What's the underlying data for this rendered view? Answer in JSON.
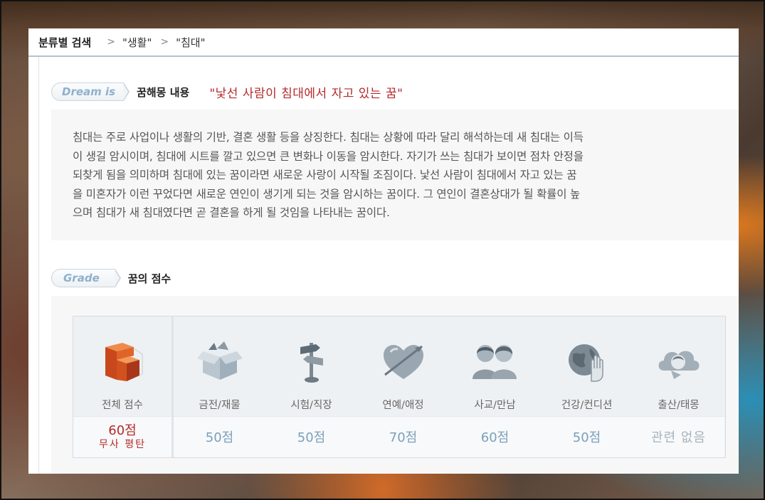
{
  "breadcrumb": {
    "title": "분류별 검색",
    "sep": ">",
    "items": [
      "\"생활\"",
      "\"침대\""
    ]
  },
  "content_section": {
    "tag": "Dream is",
    "label": "꿈해몽 내용",
    "dream_title": "\"낯선 사람이 침대에서 자고 있는 꿈\"",
    "lines": [
      "침대는 주로 사업이나 생활의 기반, 결혼 생활 등을 상징한다. 침대는 상황에 따라 달리 해석하는데 새 침대는 이득",
      "이 생길 암시이며, 침대에 시트를 깔고 있으면 큰 변화나 이동을 암시한다. 자기가 쓰는 침대가 보이면 점차 안정을",
      "되찾게 됨을 의미하며 침대에 있는 꿈이라면 새로운 사랑이 시작될 조짐이다. 낯선 사람이 침대에서 자고 있는 꿈",
      "을 미혼자가 이런 꾸었다면 새로운 연인이 생기게 되는 것을 암시하는 꿈이다. 그 연인이 결혼상대가 될 확률이 높",
      "으며 침대가 새 침대였다면 곧 결혼을 하게 될 것임을 나타내는 꿈이다."
    ]
  },
  "grade_section": {
    "tag": "Grade",
    "label": "꿈의 점수",
    "total": {
      "label": "전체 점수",
      "score": "60점",
      "verdict": "무사 평탄",
      "icon": "stacked-blocks-icon"
    },
    "categories": [
      {
        "label": "금전/재물",
        "score": "50점",
        "icon": "money-box-icon"
      },
      {
        "label": "시험/직장",
        "score": "50점",
        "icon": "signpost-icon"
      },
      {
        "label": "연예/애정",
        "score": "70점",
        "icon": "heart-arrow-icon"
      },
      {
        "label": "사교/만남",
        "score": "60점",
        "icon": "two-people-icon"
      },
      {
        "label": "건강/컨디션",
        "score": "50점",
        "icon": "globe-hand-icon"
      },
      {
        "label": "출산/태몽",
        "score": "관련 없음",
        "icon": "baby-cloud-icon"
      }
    ]
  },
  "colors": {
    "accent_red": "#b52a2a",
    "score_blue": "#7aa0bb",
    "tag_blue": "#8fb0cc"
  }
}
